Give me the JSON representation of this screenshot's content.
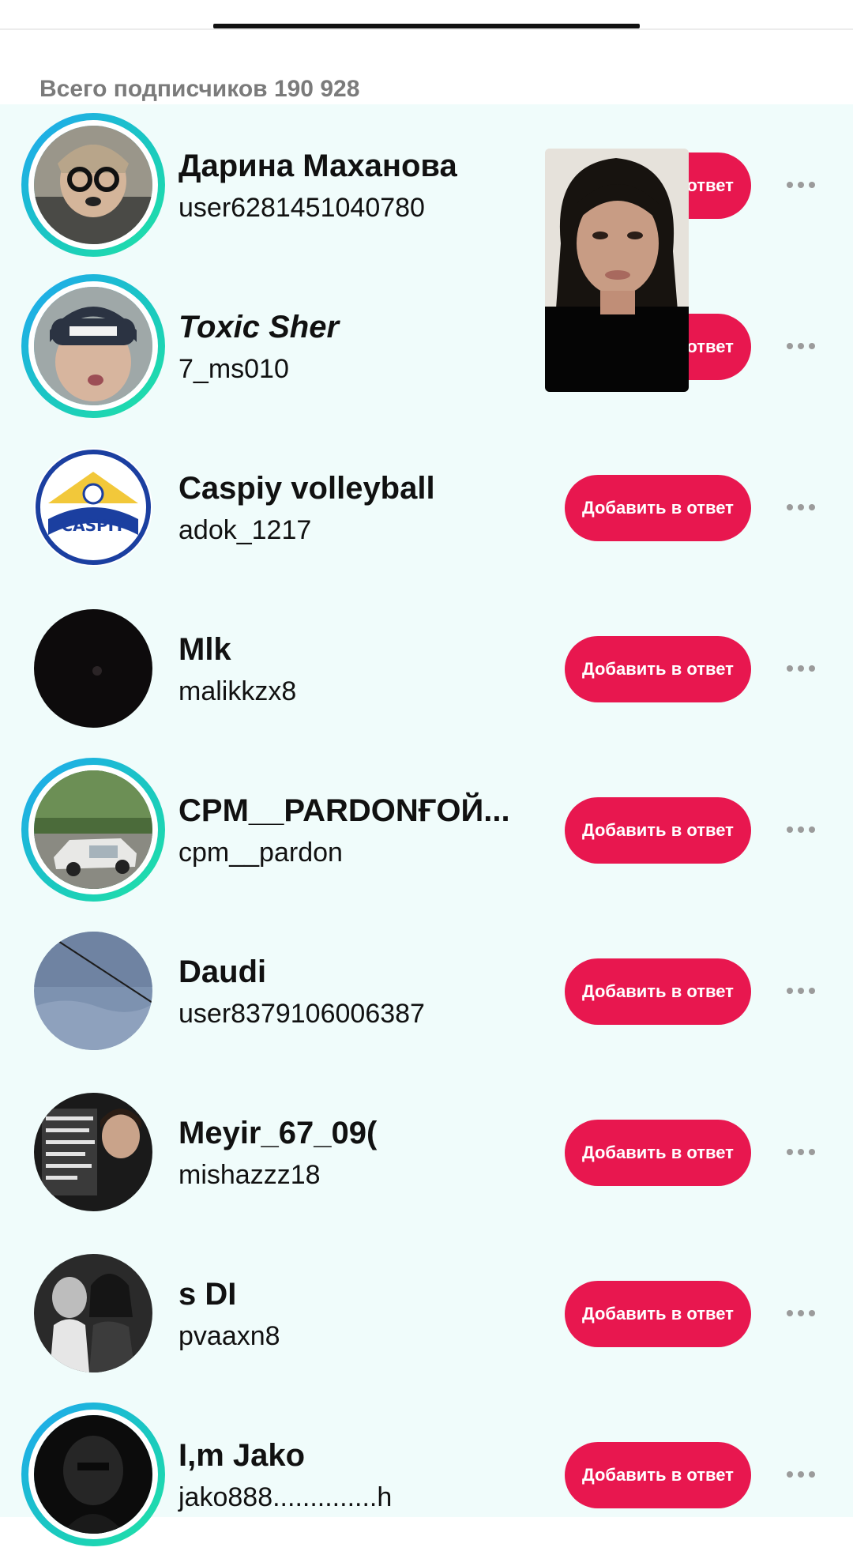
{
  "header": {
    "total_label": "Всего подписчиков 190 928"
  },
  "button_label": "Добавить в ответ",
  "followers": [
    {
      "nickname": "Дарина Маханова",
      "username": "user6281451040780",
      "ring": true,
      "italic": false
    },
    {
      "nickname": "Toxic Sher",
      "username": "7_ms010",
      "ring": true,
      "italic": true
    },
    {
      "nickname": "Caspiy volleyball",
      "username": "adok_1217",
      "ring": false,
      "italic": false
    },
    {
      "nickname": "Mlk",
      "username": "malikkzx8",
      "ring": false,
      "italic": false
    },
    {
      "nickname": "CPM__PARDONҒОЙ...",
      "username": "cpm__pardon",
      "ring": true,
      "italic": false
    },
    {
      "nickname": "Daudi",
      "username": "user8379106006387",
      "ring": false,
      "italic": false
    },
    {
      "nickname": "Meyir_67_09(",
      "username": "mishazzz18",
      "ring": false,
      "italic": false
    },
    {
      "nickname": "s DI",
      "username": "pvaaxn8",
      "ring": false,
      "italic": false
    },
    {
      "nickname": "I,m Jako",
      "username": "jako888..............h",
      "ring": true,
      "italic": false
    }
  ],
  "colors": {
    "accent": "#e8174f",
    "list_background": "#f0fcfb",
    "ring_start": "#20a6f2",
    "ring_end": "#21e3a5"
  }
}
